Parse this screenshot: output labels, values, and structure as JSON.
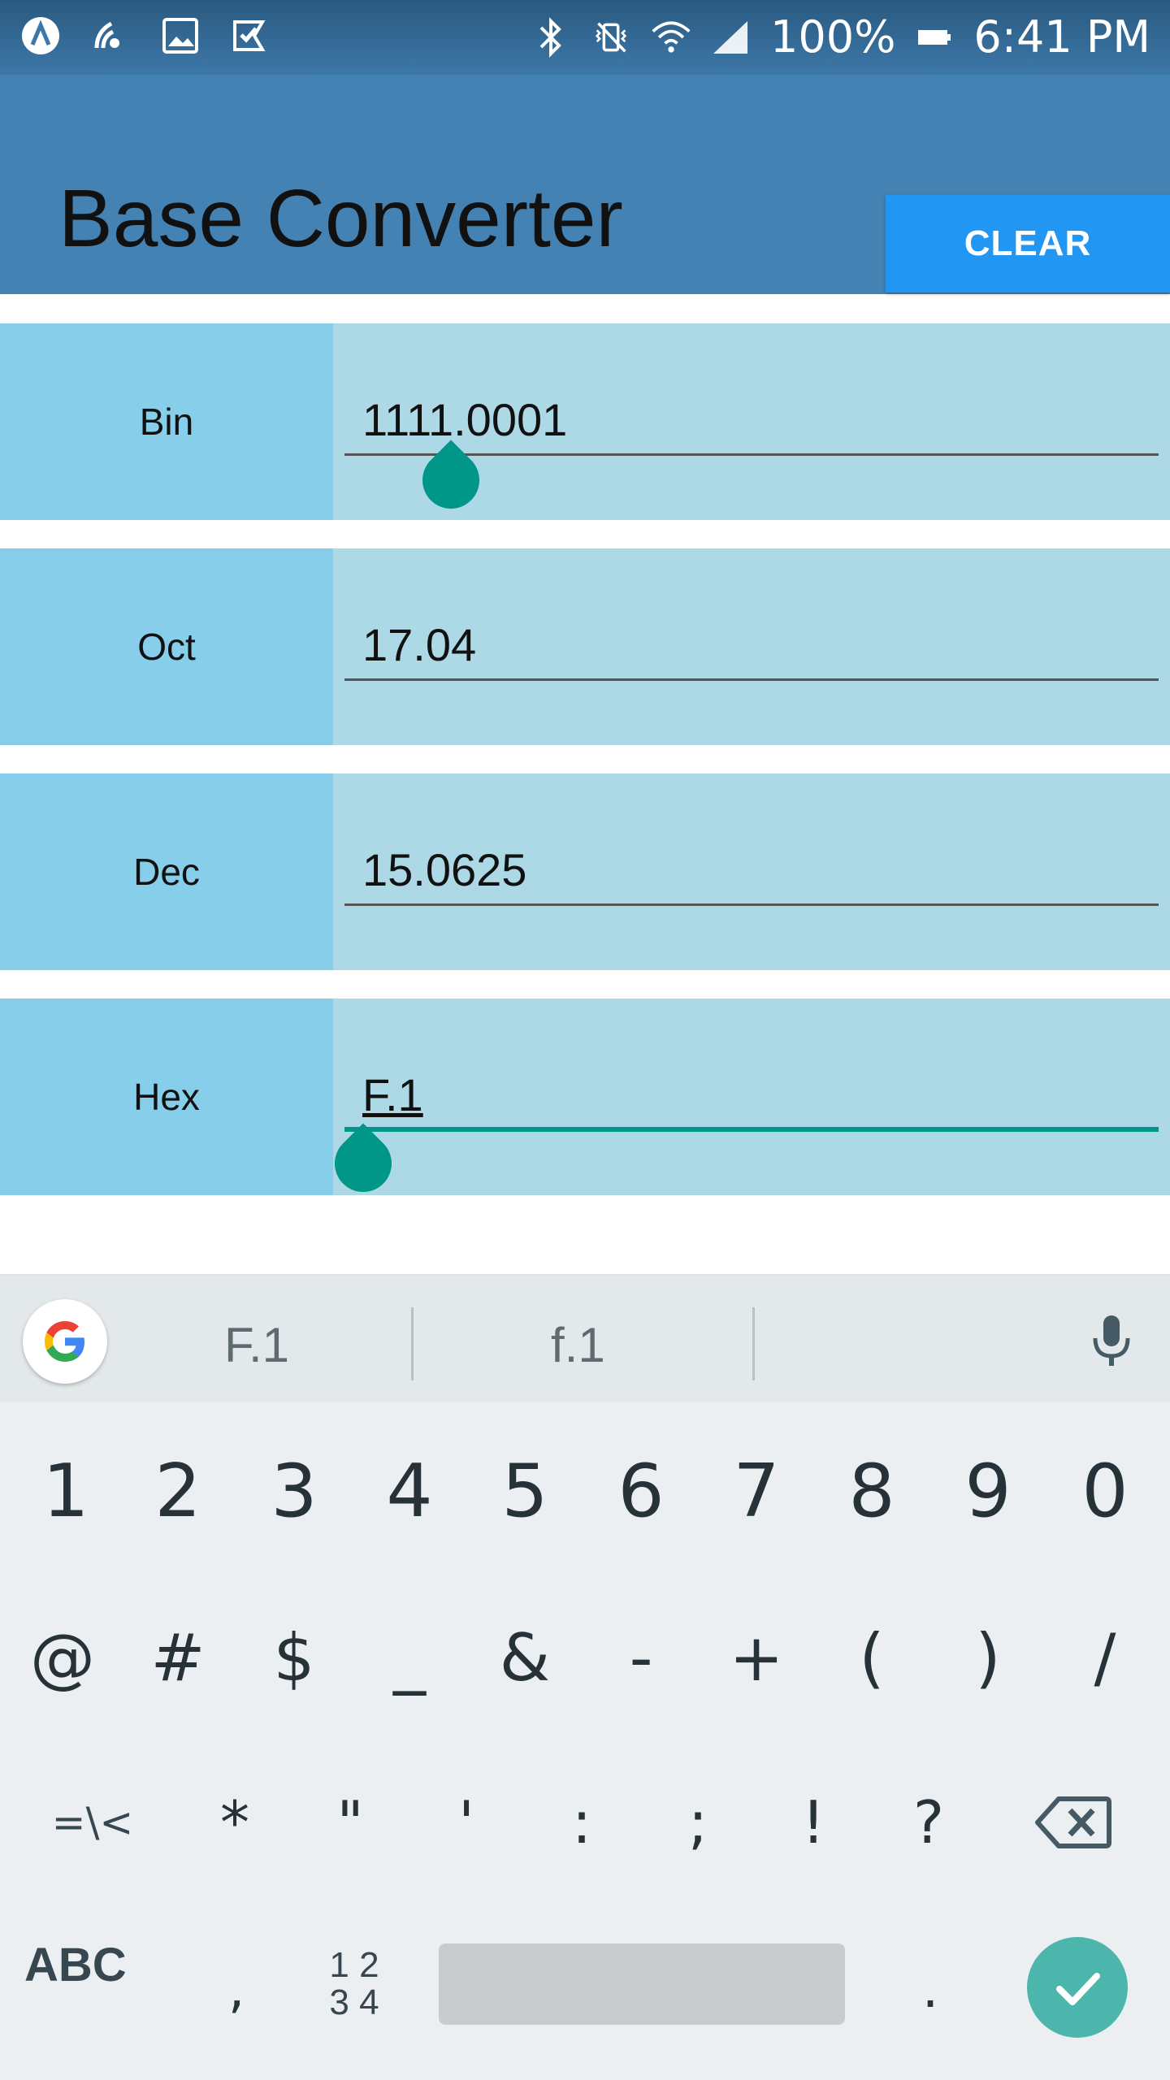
{
  "status_bar": {
    "battery": "100%",
    "time": "6:41 PM"
  },
  "app": {
    "title": "Base Converter",
    "clear_label": "CLEAR"
  },
  "rows": [
    {
      "label": "Bin",
      "value": "1111.0001"
    },
    {
      "label": "Oct",
      "value": "17.04"
    },
    {
      "label": "Dec",
      "value": "15.0625"
    },
    {
      "label": "Hex",
      "value": "F.1"
    }
  ],
  "keyboard": {
    "suggestions": [
      "F.1",
      "f.1"
    ],
    "row1": [
      "1",
      "2",
      "3",
      "4",
      "5",
      "6",
      "7",
      "8",
      "9",
      "0"
    ],
    "row2": [
      "@",
      "#",
      "$",
      "_",
      "&",
      "-",
      "+",
      "(",
      ")",
      "/"
    ],
    "row3": [
      "=\\<",
      "*",
      "\"",
      "'",
      ":",
      ";",
      "!",
      "?"
    ],
    "abc_label": "ABC",
    "comma": ",",
    "num_switch_top": "1 2",
    "num_switch_bottom": "3 4",
    "period": "."
  },
  "colors": {
    "appbar": "#4482b3",
    "clear_button": "#2196f3",
    "label_bg": "#87ceeb",
    "field_bg": "#add8e6",
    "accent": "#009688",
    "enter_key": "#4db6ac"
  }
}
